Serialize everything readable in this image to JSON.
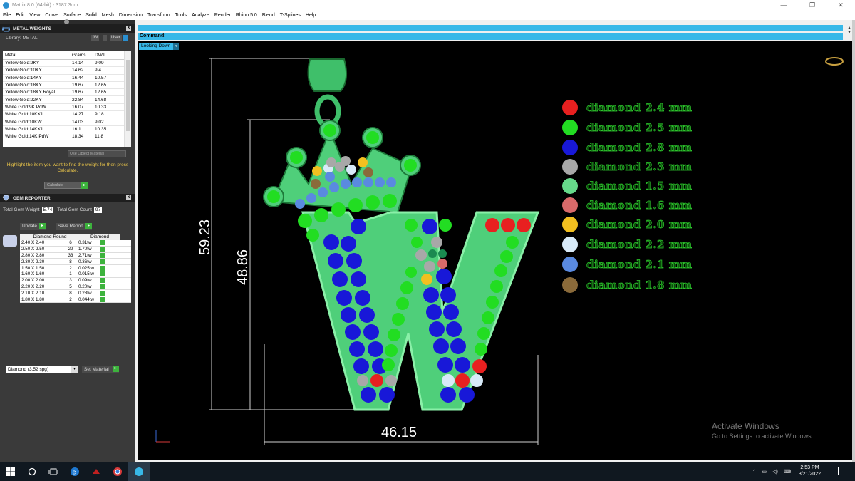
{
  "window": {
    "title": "Matrix 8.0 (64-bit) - 3187.3dm",
    "minimize": "—",
    "maximize": "❐",
    "close": "✕"
  },
  "menu": [
    "File",
    "Edit",
    "View",
    "Curve",
    "Surface",
    "Solid",
    "Mesh",
    "Dimension",
    "Transform",
    "Tools",
    "Analyze",
    "Render",
    "Rhino 5.0",
    "Blend",
    "T-Splines",
    "Help"
  ],
  "metal_panel": {
    "header": "METAL WEIGHTS",
    "library_label": "Library: METAL",
    "lib_btn1": "IW",
    "lib_btn2": "User",
    "columns": [
      "Metal",
      "Grams",
      "DWT"
    ],
    "rows": [
      {
        "metal": "Yellow Gold:9KY",
        "grams": "14.14",
        "dwt": "9.09"
      },
      {
        "metal": "Yellow Gold:10KY",
        "grams": "14.62",
        "dwt": "9.4"
      },
      {
        "metal": "Yellow Gold:14KY",
        "grams": "16.44",
        "dwt": "10.57"
      },
      {
        "metal": "Yellow Gold:18KY",
        "grams": "19.67",
        "dwt": "12.65"
      },
      {
        "metal": "Yellow Gold:18KY Royal",
        "grams": "19.67",
        "dwt": "12.65"
      },
      {
        "metal": "Yellow Gold:22KY",
        "grams": "22.84",
        "dwt": "14.68"
      },
      {
        "metal": "White Gold:9K PdW",
        "grams": "16.07",
        "dwt": "10.33"
      },
      {
        "metal": "White Gold:10KX1",
        "grams": "14.27",
        "dwt": "9.18"
      },
      {
        "metal": "White Gold:10KW",
        "grams": "14.03",
        "dwt": "9.02"
      },
      {
        "metal": "White Gold:14KX1",
        "grams": "16.1",
        "dwt": "10.35"
      },
      {
        "metal": "White Gold:14K PdW",
        "grams": "18.34",
        "dwt": "11.8"
      }
    ],
    "use_object_material": "Use Object Material",
    "instruction": "Highlight the item you want to find the weight for then press Calculate.",
    "calculate": "Calculate"
  },
  "gem_panel": {
    "header": "GEM REPORTER",
    "total_weight_label": "Total Gem Weight",
    "total_weight": "5.74",
    "total_count_label": "Total Gem Count",
    "total_count": "97",
    "update": "Update",
    "save_report": "Save Report",
    "columns": [
      "Diamond Round",
      "Diamond"
    ],
    "rows": [
      {
        "size": "2.40 X 2.40",
        "count": "6",
        "tw": "0.31tw"
      },
      {
        "size": "2.50 X 2.50",
        "count": "29",
        "tw": "1.70tw"
      },
      {
        "size": "2.80 X 2.80",
        "count": "33",
        "tw": "2.71tw"
      },
      {
        "size": "2.30 X 2.30",
        "count": "8",
        "tw": "0.36tw"
      },
      {
        "size": "1.50 X 1.50",
        "count": "2",
        "tw": "0.025tw"
      },
      {
        "size": "1.60 X 1.60",
        "count": "1",
        "tw": "0.015tw"
      },
      {
        "size": "2.00 X 2.00",
        "count": "3",
        "tw": "0.09tw"
      },
      {
        "size": "2.20 X 2.20",
        "count": "5",
        "tw": "0.20tw"
      },
      {
        "size": "2.10 X 2.10",
        "count": "8",
        "tw": "0.28tw"
      },
      {
        "size": "1.80 X 1.80",
        "count": "2",
        "tw": "0.044tw"
      }
    ],
    "material_select": "Diamond    (3.52 spg)",
    "set_material": "Set Material"
  },
  "command": {
    "label": "Command:"
  },
  "viewport": {
    "view_label": "Looking Down",
    "dim_height_outer": "59.23",
    "dim_height_inner": "48.86",
    "dim_width": "46.15",
    "legend": [
      {
        "label": "diamond 2.4 mm",
        "color": "#e82020"
      },
      {
        "label": "diamond 2.5 mm",
        "color": "#22dd22"
      },
      {
        "label": "diamond 2.8 mm",
        "color": "#1818d8"
      },
      {
        "label": "diamond 2.3 mm",
        "color": "#a8a8a8"
      },
      {
        "label": "diamond 1.5 mm",
        "color": "#66d98a"
      },
      {
        "label": "diamond 1.6 mm",
        "color": "#d86a6a"
      },
      {
        "label": "diamond 2.0 mm",
        "color": "#f2c020"
      },
      {
        "label": "diamond  2.2 mm",
        "color": "#d8eaf8"
      },
      {
        "label": "diamond 2.1 mm",
        "color": "#5a8ae0"
      },
      {
        "label": "diamond 1.8 mm",
        "color": "#8a6a3a"
      }
    ],
    "watermark_title": "Activate Windows",
    "watermark_sub": "Go to Settings to activate Windows."
  },
  "taskbar": {
    "time": "2:53 PM",
    "date": "3/21/2022"
  },
  "colors": {
    "accent": "#38b8e8",
    "pendant": "#4fcf7a",
    "panel": "#3a3a3a"
  }
}
